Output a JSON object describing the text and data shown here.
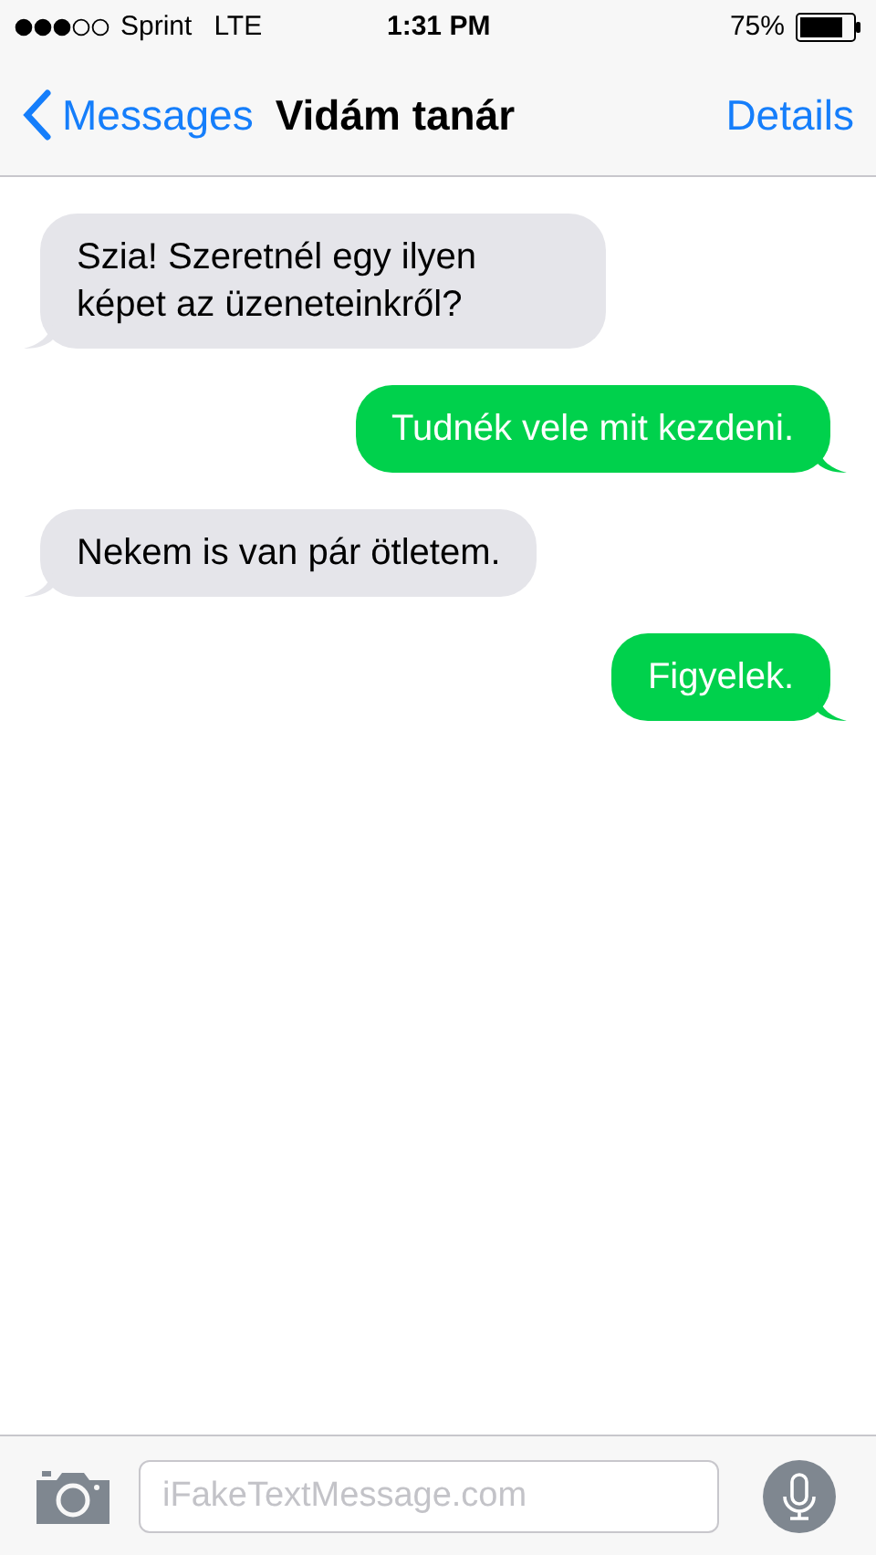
{
  "status_bar": {
    "carrier": "Sprint",
    "network": "LTE",
    "time": "1:31 PM",
    "battery": "75%"
  },
  "nav": {
    "back": "Messages",
    "title": "Vidám tanár",
    "action": "Details"
  },
  "messages": [
    {
      "kind": "received",
      "text": "Szia! Szeretnél egy ilyen képet az üzeneteinkről?"
    },
    {
      "kind": "sent",
      "text": "Tudnék vele mit kezdeni."
    },
    {
      "kind": "received",
      "text": "Nekem is van pár ötletem."
    },
    {
      "kind": "sent",
      "text": "Figyelek."
    }
  ],
  "composer": {
    "placeholder": "iFakeTextMessage.com"
  }
}
